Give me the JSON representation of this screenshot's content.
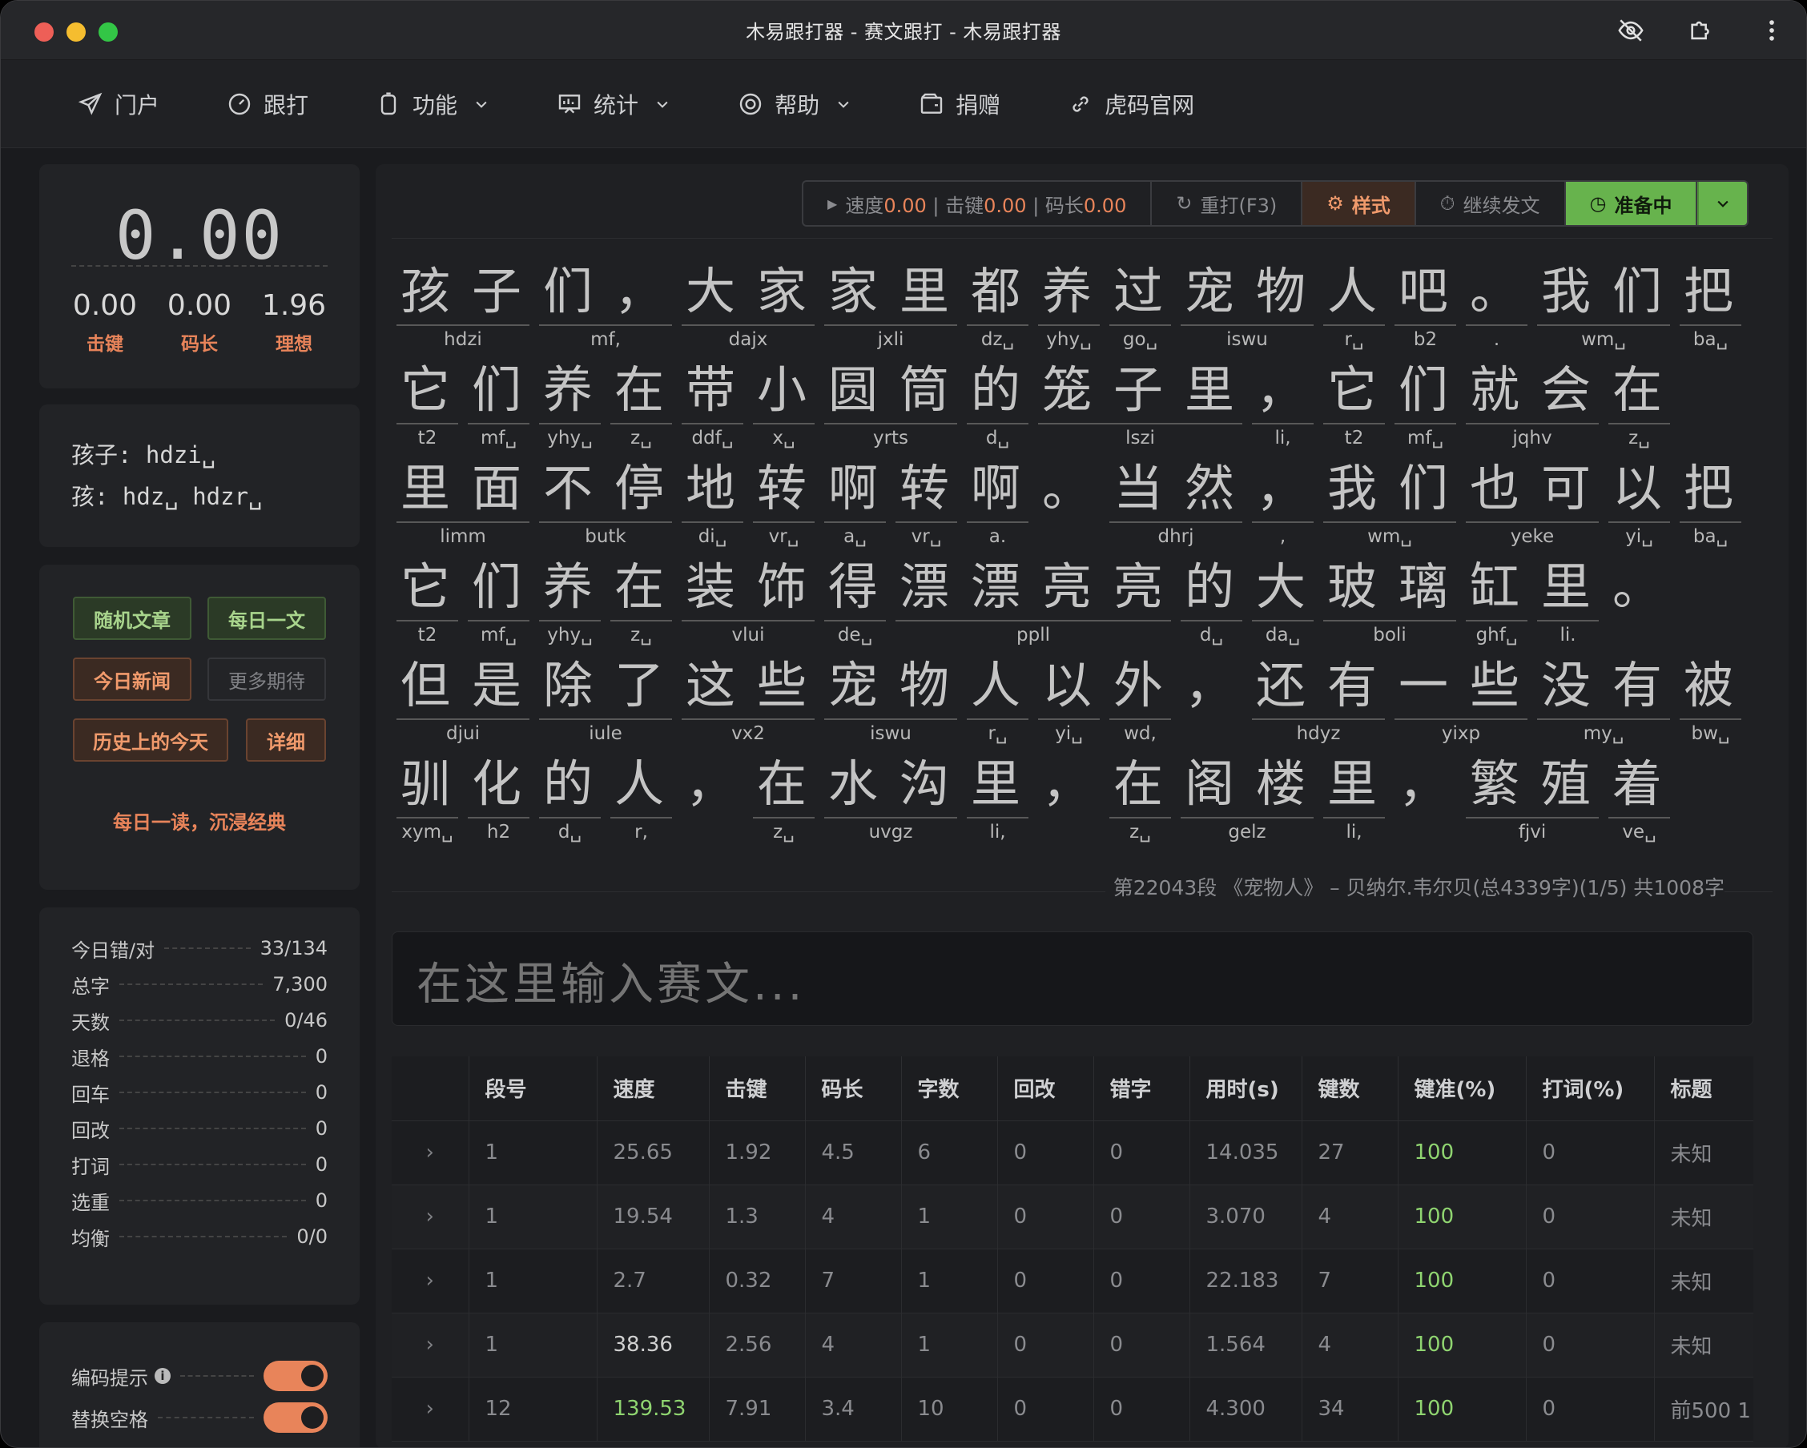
{
  "window": {
    "title": "木易跟打器 - 赛文跟打 - 木易跟打器"
  },
  "nav": [
    {
      "label": "门户",
      "icon": "paper-plane-icon"
    },
    {
      "label": "跟打",
      "icon": "speedometer-icon"
    },
    {
      "label": "功能",
      "icon": "timer-icon",
      "dropdown": true
    },
    {
      "label": "统计",
      "icon": "chart-board-icon",
      "dropdown": true
    },
    {
      "label": "帮助",
      "icon": "lifebuoy-icon",
      "dropdown": true
    },
    {
      "label": "捐赠",
      "icon": "wallet-icon"
    },
    {
      "label": "虎码官网",
      "icon": "link-icon"
    }
  ],
  "speed_panel": {
    "speed": "0.00",
    "stats": [
      {
        "value": "0.00",
        "label": "击键"
      },
      {
        "value": "0.00",
        "label": "码长"
      },
      {
        "value": "1.96",
        "label": "理想"
      }
    ]
  },
  "code_hint": {
    "line1": "孩子: hdzi␣",
    "line2": "孩: hdz␣ hdzr␣"
  },
  "article_buttons": {
    "random": "随机文章",
    "daily": "每日一文",
    "news": "今日新闻",
    "more": "更多期待",
    "history": "历史上的今天",
    "detail": "详细",
    "motto": "每日一读，沉浸经典"
  },
  "daily_stats": [
    {
      "label": "今日错/对",
      "value": "33/134"
    },
    {
      "label": "总字",
      "value": "7,300"
    },
    {
      "label": "天数",
      "value": "0/46"
    },
    {
      "label": "退格",
      "value": "0"
    },
    {
      "label": "回车",
      "value": "0"
    },
    {
      "label": "回改",
      "value": "0"
    },
    {
      "label": "打词",
      "value": "0"
    },
    {
      "label": "选重",
      "value": "0"
    },
    {
      "label": "均衡",
      "value": "0/0"
    }
  ],
  "settings": [
    {
      "label": "编码提示",
      "on": true
    },
    {
      "label": "替换空格",
      "on": true
    }
  ],
  "toolbar": {
    "speed_label": "速度",
    "speed_value": "0.00",
    "keys_label": "击键",
    "keys_value": "0.00",
    "len_label": "码长",
    "len_value": "0.00",
    "retype": "重打(F3)",
    "style": "样式",
    "continue": "继续发文",
    "ready": "准备中"
  },
  "text_rows": [
    {
      "chars": [
        "孩",
        "子",
        "们",
        "，",
        "大",
        "家",
        "家",
        "里",
        "都",
        "养",
        "过",
        "宠",
        "物",
        "人",
        "吧",
        "。",
        "我",
        "们",
        "把"
      ],
      "codes": [
        {
          "s": 0,
          "n": 2,
          "c": "hdzi"
        },
        {
          "s": 2,
          "n": 2,
          "c": "mf,"
        },
        {
          "s": 4,
          "n": 2,
          "c": "dajx"
        },
        {
          "s": 6,
          "n": 2,
          "c": "jxli"
        },
        {
          "s": 8,
          "n": 1,
          "c": "dz␣"
        },
        {
          "s": 9,
          "n": 1,
          "c": "yhy␣"
        },
        {
          "s": 10,
          "n": 1,
          "c": "go␣"
        },
        {
          "s": 11,
          "n": 2,
          "c": "iswu"
        },
        {
          "s": 13,
          "n": 1,
          "c": "r␣"
        },
        {
          "s": 14,
          "n": 1,
          "c": "b2"
        },
        {
          "s": 15,
          "n": 1,
          "c": "."
        },
        {
          "s": 16,
          "n": 2,
          "c": "wm␣"
        },
        {
          "s": 18,
          "n": 1,
          "c": "ba␣"
        }
      ]
    },
    {
      "chars": [
        "它",
        "们",
        "养",
        "在",
        "带",
        "小",
        "圆",
        "筒",
        "的",
        "笼",
        "子",
        "里",
        "，",
        "它",
        "们",
        "就",
        "会",
        "在"
      ],
      "codes": [
        {
          "s": 0,
          "n": 1,
          "c": "t2"
        },
        {
          "s": 1,
          "n": 1,
          "c": "mf␣"
        },
        {
          "s": 2,
          "n": 1,
          "c": "yhy␣"
        },
        {
          "s": 3,
          "n": 1,
          "c": "z␣"
        },
        {
          "s": 4,
          "n": 1,
          "c": "ddf␣"
        },
        {
          "s": 5,
          "n": 1,
          "c": "x␣"
        },
        {
          "s": 6,
          "n": 2,
          "c": "yrts"
        },
        {
          "s": 8,
          "n": 1,
          "c": "d␣"
        },
        {
          "s": 9,
          "n": 3,
          "c": "lszi"
        },
        {
          "s": 12,
          "n": 1,
          "c": "li,"
        },
        {
          "s": 13,
          "n": 1,
          "c": "t2"
        },
        {
          "s": 14,
          "n": 1,
          "c": "mf␣"
        },
        {
          "s": 15,
          "n": 2,
          "c": "jqhv"
        },
        {
          "s": 17,
          "n": 1,
          "c": "z␣"
        }
      ]
    },
    {
      "chars": [
        "里",
        "面",
        "不",
        "停",
        "地",
        "转",
        "啊",
        "转",
        "啊",
        "。",
        "当",
        "然",
        "，",
        "我",
        "们",
        "也",
        "可",
        "以",
        "把"
      ],
      "codes": [
        {
          "s": 0,
          "n": 2,
          "c": "limm"
        },
        {
          "s": 2,
          "n": 2,
          "c": "butk"
        },
        {
          "s": 4,
          "n": 1,
          "c": "di␣"
        },
        {
          "s": 5,
          "n": 1,
          "c": "vr␣"
        },
        {
          "s": 6,
          "n": 1,
          "c": "a␣"
        },
        {
          "s": 7,
          "n": 1,
          "c": "vr␣"
        },
        {
          "s": 8,
          "n": 1,
          "c": "a."
        },
        {
          "s": 10,
          "n": 2,
          "c": "dhrj"
        },
        {
          "s": 12,
          "n": 1,
          "c": ","
        },
        {
          "s": 13,
          "n": 2,
          "c": "wm␣"
        },
        {
          "s": 15,
          "n": 2,
          "c": "yeke"
        },
        {
          "s": 17,
          "n": 1,
          "c": "yi␣"
        },
        {
          "s": 18,
          "n": 1,
          "c": "ba␣"
        }
      ]
    },
    {
      "chars": [
        "它",
        "们",
        "养",
        "在",
        "装",
        "饰",
        "得",
        "漂",
        "漂",
        "亮",
        "亮",
        "的",
        "大",
        "玻",
        "璃",
        "缸",
        "里",
        "。"
      ],
      "codes": [
        {
          "s": 0,
          "n": 1,
          "c": "t2"
        },
        {
          "s": 1,
          "n": 1,
          "c": "mf␣"
        },
        {
          "s": 2,
          "n": 1,
          "c": "yhy␣"
        },
        {
          "s": 3,
          "n": 1,
          "c": "z␣"
        },
        {
          "s": 4,
          "n": 2,
          "c": "vlui"
        },
        {
          "s": 6,
          "n": 1,
          "c": "de␣"
        },
        {
          "s": 7,
          "n": 4,
          "c": "ppll"
        },
        {
          "s": 11,
          "n": 1,
          "c": "d␣"
        },
        {
          "s": 12,
          "n": 1,
          "c": "da␣"
        },
        {
          "s": 13,
          "n": 2,
          "c": "boli"
        },
        {
          "s": 15,
          "n": 1,
          "c": "ghf␣"
        },
        {
          "s": 16,
          "n": 1,
          "c": "li."
        }
      ]
    },
    {
      "chars": [
        "但",
        "是",
        "除",
        "了",
        "这",
        "些",
        "宠",
        "物",
        "人",
        "以",
        "外",
        "，",
        "还",
        "有",
        "一",
        "些",
        "没",
        "有",
        "被"
      ],
      "codes": [
        {
          "s": 0,
          "n": 2,
          "c": "djui"
        },
        {
          "s": 2,
          "n": 2,
          "c": "iule"
        },
        {
          "s": 4,
          "n": 2,
          "c": "vx2"
        },
        {
          "s": 6,
          "n": 2,
          "c": "iswu"
        },
        {
          "s": 8,
          "n": 1,
          "c": "r␣"
        },
        {
          "s": 9,
          "n": 1,
          "c": "yi␣"
        },
        {
          "s": 10,
          "n": 1,
          "c": "wd,"
        },
        {
          "s": 12,
          "n": 2,
          "c": "hdyz"
        },
        {
          "s": 14,
          "n": 2,
          "c": "yixp"
        },
        {
          "s": 16,
          "n": 2,
          "c": "my␣"
        },
        {
          "s": 18,
          "n": 1,
          "c": "bw␣"
        }
      ]
    },
    {
      "chars": [
        "驯",
        "化",
        "的",
        "人",
        "，",
        "在",
        "水",
        "沟",
        "里",
        "，",
        "在",
        "阁",
        "楼",
        "里",
        "，",
        "繁",
        "殖",
        "着"
      ],
      "codes": [
        {
          "s": 0,
          "n": 1,
          "c": "xym␣"
        },
        {
          "s": 1,
          "n": 1,
          "c": "h2"
        },
        {
          "s": 2,
          "n": 1,
          "c": "d␣"
        },
        {
          "s": 3,
          "n": 1,
          "c": "r,"
        },
        {
          "s": 5,
          "n": 1,
          "c": "z␣"
        },
        {
          "s": 6,
          "n": 2,
          "c": "uvgz"
        },
        {
          "s": 8,
          "n": 1,
          "c": "li,"
        },
        {
          "s": 10,
          "n": 1,
          "c": "z␣"
        },
        {
          "s": 11,
          "n": 2,
          "c": "gelz"
        },
        {
          "s": 13,
          "n": 1,
          "c": "li,"
        },
        {
          "s": 15,
          "n": 2,
          "c": "fjvi"
        },
        {
          "s": 17,
          "n": 1,
          "c": "ve␣"
        }
      ]
    }
  ],
  "source": "第22043段 《宠物人》 – 贝纳尔.韦尔贝(总4339字)(1/5) 共1008字",
  "input": {
    "placeholder": "在这里输入赛文..."
  },
  "table": {
    "headers": [
      "段号",
      "速度",
      "击键",
      "码长",
      "字数",
      "回改",
      "错字",
      "用时(s)",
      "键数",
      "键准(%)",
      "打词(%)",
      "标题"
    ],
    "rows": [
      [
        "1",
        "25.65",
        "1.92",
        "4.5",
        "6",
        "0",
        "0",
        "14.035",
        "27",
        "100",
        "0",
        "未知"
      ],
      [
        "1",
        "19.54",
        "1.3",
        "4",
        "1",
        "0",
        "0",
        "3.070",
        "4",
        "100",
        "0",
        "未知"
      ],
      [
        "1",
        "2.7",
        "0.32",
        "7",
        "1",
        "0",
        "0",
        "22.183",
        "7",
        "100",
        "0",
        "未知"
      ],
      [
        "1",
        "38.36",
        "2.56",
        "4",
        "1",
        "0",
        "0",
        "1.564",
        "4",
        "100",
        "0",
        "未知"
      ],
      [
        "12",
        "139.53",
        "7.91",
        "3.4",
        "10",
        "0",
        "0",
        "4.300",
        "34",
        "100",
        "0",
        "前500 1"
      ]
    ]
  },
  "colors": {
    "accent": "#e8845a",
    "green": "#67b34d",
    "bg": "#1a1b1e"
  }
}
